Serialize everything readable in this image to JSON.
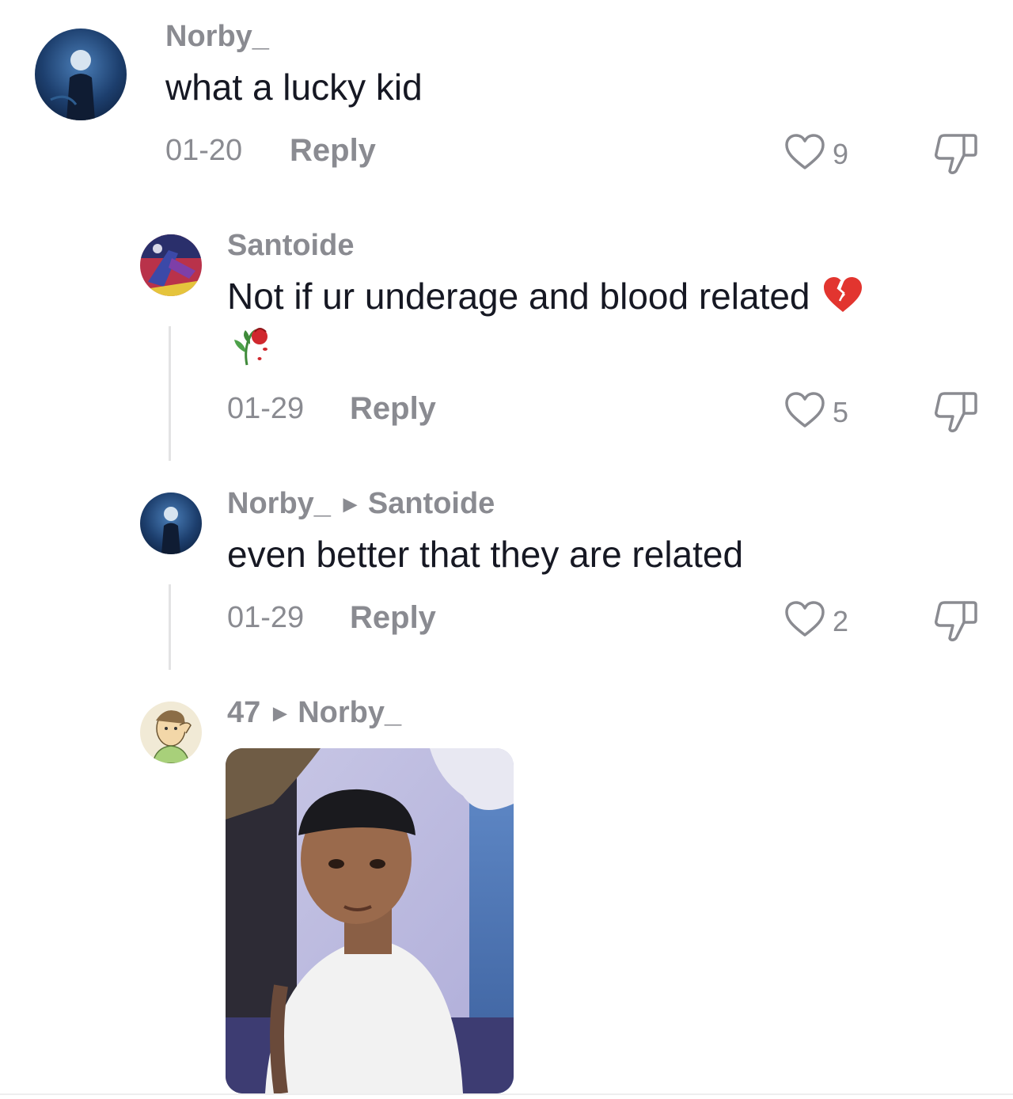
{
  "comments": [
    {
      "username": "Norby_",
      "text": "what a lucky kid",
      "date": "01-20",
      "reply_label": "Reply",
      "likes": "9"
    },
    {
      "username": "Santoide",
      "text": "Not if ur underage and blood related",
      "emojis": [
        "broken-heart",
        "wilted-rose"
      ],
      "date": "01-29",
      "reply_label": "Reply",
      "likes": "5"
    },
    {
      "username": "Norby_",
      "reply_to": "Santoide",
      "text": "even better that they are related",
      "date": "01-29",
      "reply_label": "Reply",
      "likes": "2"
    },
    {
      "username": "47",
      "reply_to": "Norby_",
      "media": "gif-image"
    }
  ],
  "colors": {
    "secondary_text": "#8a8b91",
    "primary_text": "#161823",
    "thread_line": "#e3e3e4",
    "background": "#ffffff"
  },
  "icons": [
    "heart-outline-icon",
    "thumbs-down-icon",
    "caret-right-icon"
  ]
}
